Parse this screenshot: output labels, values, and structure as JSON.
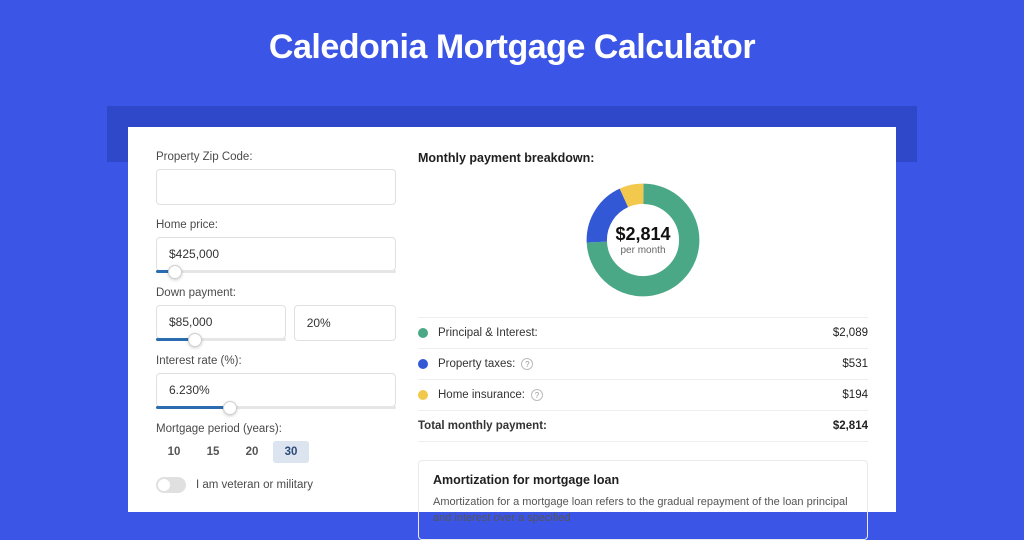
{
  "title": "Caledonia Mortgage Calculator",
  "form": {
    "zip_label": "Property Zip Code:",
    "zip_value": "",
    "home_price_label": "Home price:",
    "home_price_value": "$425,000",
    "home_price_slider_pct": 8,
    "down_label": "Down payment:",
    "down_amount": "$85,000",
    "down_pct": "20%",
    "down_slider_pct": 20,
    "rate_label": "Interest rate (%):",
    "rate_value": "6.230%",
    "rate_slider_pct": 31,
    "period_label": "Mortgage period (years):",
    "periods": [
      "10",
      "15",
      "20",
      "30"
    ],
    "period_selected_index": 3,
    "veteran_label": "I am veteran or military",
    "veteran_on": false
  },
  "breakdown": {
    "title": "Monthly payment breakdown:",
    "donut_amount": "$2,814",
    "donut_sub": "per month",
    "rows": [
      {
        "label": "Principal & Interest:",
        "value": "$2,089",
        "color": "green",
        "help": false
      },
      {
        "label": "Property taxes:",
        "value": "$531",
        "color": "blue",
        "help": true
      },
      {
        "label": "Home insurance:",
        "value": "$194",
        "color": "yellow",
        "help": true
      }
    ],
    "total_label": "Total monthly payment:",
    "total_value": "$2,814"
  },
  "amortization": {
    "title": "Amortization for mortgage loan",
    "text": "Amortization for a mortgage loan refers to the gradual repayment of the loan principal and interest over a specified"
  },
  "chart_data": {
    "type": "pie",
    "title": "Monthly payment breakdown",
    "series": [
      {
        "name": "Principal & Interest",
        "value": 2089,
        "color": "#4aa886"
      },
      {
        "name": "Property taxes",
        "value": 531,
        "color": "#3358d6"
      },
      {
        "name": "Home insurance",
        "value": 194,
        "color": "#f2c94c"
      }
    ],
    "total": 2814,
    "center_label": "$2,814 per month"
  }
}
